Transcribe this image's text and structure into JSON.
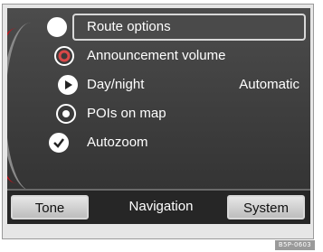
{
  "menu": {
    "items": [
      {
        "icon": "radio-selected-icon",
        "label": "Route options",
        "value": ""
      },
      {
        "icon": "volume-ring-icon",
        "label": "Announcement volume",
        "value": ""
      },
      {
        "icon": "play-arrow-icon",
        "label": "Day/night",
        "value": "Automatic"
      },
      {
        "icon": "radio-dot-icon",
        "label": "POIs on map",
        "value": ""
      },
      {
        "icon": "checkbox-checked-icon",
        "label": "Autozoom",
        "value": ""
      }
    ]
  },
  "softkeys": {
    "tone": "Tone",
    "navigation": "Navigation",
    "system": "System"
  },
  "code_label": "B5P-0603",
  "colors": {
    "accent_red": "#c8101a",
    "screen_bg": "#3c3c3c",
    "text": "#ffffff"
  }
}
